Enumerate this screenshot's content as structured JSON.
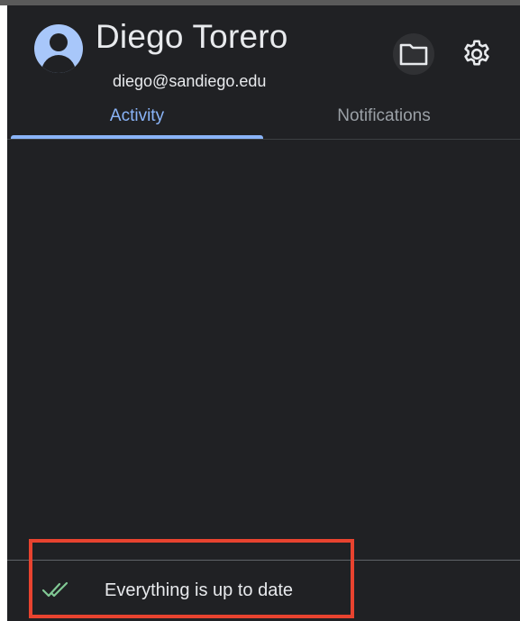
{
  "profile": {
    "name": "Diego Torero",
    "email": "diego@sandiego.edu",
    "avatar_icon": "account-circle-icon"
  },
  "header_actions": {
    "folder_icon": "folder-icon",
    "settings_icon": "gear-icon"
  },
  "tabs": [
    {
      "label": "Activity",
      "selected": true
    },
    {
      "label": "Notifications",
      "selected": false
    }
  ],
  "status": {
    "text": "Everything is up to date",
    "icon": "double-check-icon",
    "icon_color": "#81c995"
  },
  "colors": {
    "panel_bg": "#202124",
    "accent": "#8ab4f8",
    "avatar": "#a8c7fa",
    "highlight": "#e8432f"
  }
}
